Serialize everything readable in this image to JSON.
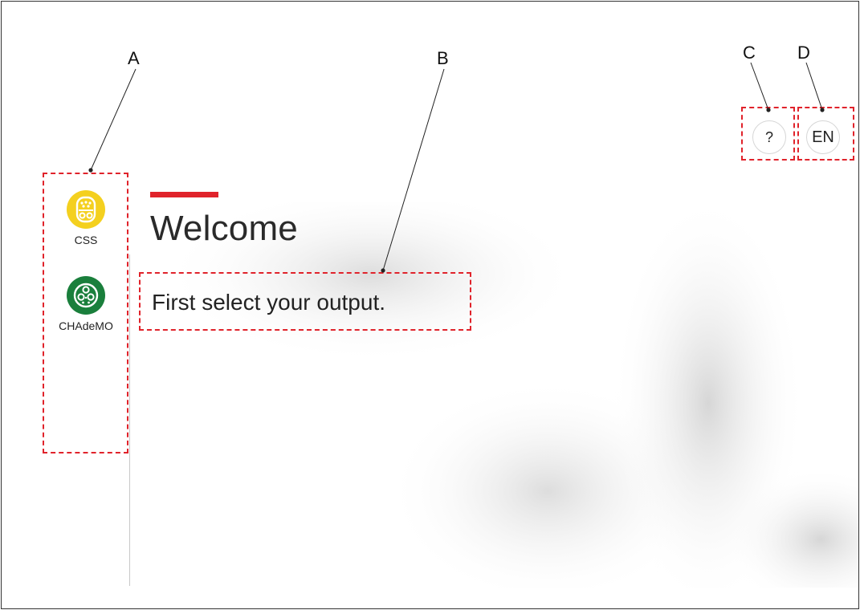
{
  "colors": {
    "accent": "#e0232b",
    "css_connector": "#f4d01f",
    "chademo_connector": "#1a7f3c",
    "callout": "#e0232b"
  },
  "header": {
    "title": "Welcome",
    "subtitle": "First select your output."
  },
  "outputs": [
    {
      "label": "CSS",
      "icon": "css-connector-icon"
    },
    {
      "label": "CHAdeMO",
      "icon": "chademo-connector-icon"
    }
  ],
  "toolbar": {
    "help_label": "?",
    "language_label": "EN"
  },
  "callouts": {
    "A": "A",
    "B": "B",
    "C": "C",
    "D": "D"
  }
}
